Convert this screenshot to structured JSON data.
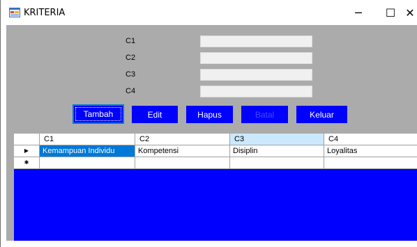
{
  "window": {
    "title": "KRITERIA",
    "min_glyph": "─",
    "max_glyph": "☐",
    "close_glyph": "✕"
  },
  "form": {
    "fields": [
      {
        "label": "C1",
        "value": ""
      },
      {
        "label": "C2",
        "value": ""
      },
      {
        "label": "C3",
        "value": ""
      },
      {
        "label": "C4",
        "value": ""
      }
    ],
    "buttons": {
      "tambah": "Tambah",
      "edit": "Edit",
      "hapus": "Hapus",
      "batal": "Batal",
      "keluar": "Keluar"
    }
  },
  "grid": {
    "columns": [
      "C1",
      "C2",
      "C3",
      "C4"
    ],
    "rows": [
      {
        "indicator": "▶",
        "cells": [
          "Kemampuan Individu",
          "Kompetensi",
          "Disiplin",
          "Loyalitas"
        ]
      }
    ],
    "new_row_indicator": "✱"
  },
  "colors": {
    "client_bg": "#ababab",
    "button_bg": "#0000ff",
    "grid_bg": "#0000ff",
    "selection": "#0078d7"
  }
}
